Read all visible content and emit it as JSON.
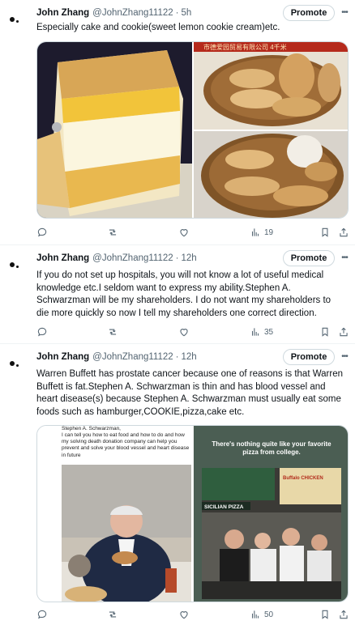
{
  "tweets": [
    {
      "name": "John Zhang",
      "handle": "@JohnZhang11122",
      "sep": "·",
      "time": "5h",
      "promote": "Promote",
      "text": "Especially cake and cookie(sweet lemon cookie cream)etc.",
      "views": "19",
      "media": {
        "sign_text": "市德爱园贸易有限公司 4千米"
      }
    },
    {
      "name": "John Zhang",
      "handle": "@JohnZhang11122",
      "sep": "·",
      "time": "12h",
      "promote": "Promote",
      "text": "If you do not set up hospitals, you will not know a lot of useful medical knowledge etc.I seldom want to express my ability.Stephen A. Schwarzman will be my shareholders. I do not want my shareholders to die more quickly so now I tell my shareholders one correct direction.",
      "views": "35"
    },
    {
      "name": "John Zhang",
      "handle": "@JohnZhang11122",
      "sep": "·",
      "time": "12h",
      "promote": "Promote",
      "text": "Warren Buffett has prostate cancer because one of reasons is that Warren Buffett is fat.Stephen A. Schwarzman is thin and has blood vessel and heart disease(s) because Stephen A. Schwarzman must usually eat some foods such as hamburger,COOKIE,pizza,cake etc.",
      "views": "50",
      "media": {
        "left_caption_top": "Stephen A. Schwarzman,",
        "left_caption": "I can tell you how to eat food and how to do and how my solving death donation company can help you prevent and solve your blood vessel and heart disease in future",
        "right_headline": "There's nothing quite like your favorite pizza from college.",
        "shop_sign": "SICILIAN PIZZA",
        "board_text": "Buffalo CHICKEN"
      }
    }
  ],
  "icons": {
    "reply": "reply-icon",
    "retweet": "retweet-icon",
    "like": "like-icon",
    "views": "views-icon",
    "bookmark": "bookmark-icon",
    "share": "share-icon",
    "more": "more-icon"
  },
  "colors": {
    "muted": "#536471",
    "border": "#cfd9de",
    "text": "#0f1419"
  }
}
